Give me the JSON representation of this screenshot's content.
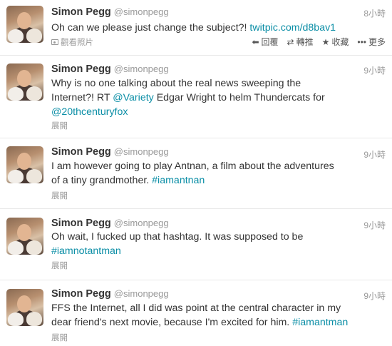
{
  "tweets": [
    {
      "name": "Simon Pegg",
      "handle": "@simonpegg",
      "time": "8小時",
      "text_parts": [
        "Oh can we please just change the subject?! ",
        "twitpic.com/d8bav1",
        ""
      ],
      "expand_label": "觀看照片",
      "actions": {
        "reply": "回覆",
        "retweet": "轉推",
        "favorite": "收藏",
        "more": "更多"
      }
    },
    {
      "name": "Simon Pegg",
      "handle": "@simonpegg",
      "time": "9小時",
      "line1": "Why is no one talking about the real news sweeping the",
      "line2_pre": "Internet?! RT ",
      "line2_mention": "@Variety",
      "line2_post": " Edgar Wright to helm Thundercats for",
      "line3_mention": "@20thcenturyfox",
      "expand_label": "展開"
    },
    {
      "name": "Simon Pegg",
      "handle": "@simonpegg",
      "time": "9小時",
      "line1": "I am however going to play Antnan, a film about the adventures",
      "line2_pre": "of a tiny grandmother. ",
      "line2_hashtag": "#iamantnan",
      "expand_label": "展開"
    },
    {
      "name": "Simon Pegg",
      "handle": "@simonpegg",
      "time": "9小時",
      "line1": "Oh wait, I fucked up that hashtag. It was supposed to be",
      "line2_hashtag": "#iamnotantman",
      "expand_label": "展開"
    },
    {
      "name": "Simon Pegg",
      "handle": "@simonpegg",
      "time": "9小時",
      "line1": "FFS the Internet, all I did was point at the central character in my",
      "line2_pre": "dear friend's next movie, because I'm excited for him. ",
      "line2_hashtag": "#iamantman",
      "expand_label": "展開"
    }
  ]
}
